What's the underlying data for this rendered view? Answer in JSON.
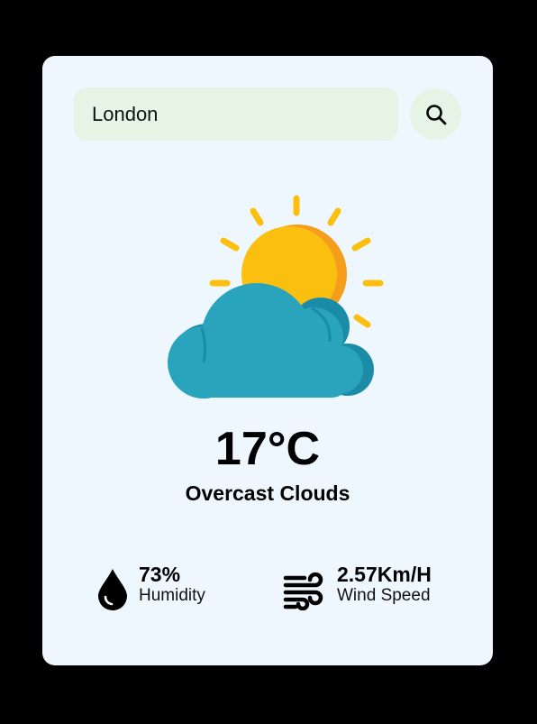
{
  "search": {
    "value": "London",
    "button_icon": "search-icon"
  },
  "weather": {
    "icon": "sun-behind-cloud-icon",
    "temperature": "17°C",
    "condition": "Overcast Clouds"
  },
  "stats": {
    "humidity": {
      "icon": "water-drop-icon",
      "value": "73%",
      "label": "Humidity"
    },
    "wind": {
      "icon": "wind-icon",
      "value": "2.57Km/H",
      "label": "Wind Speed"
    }
  },
  "colors": {
    "background": "#000000",
    "card": "#eff7fe",
    "search_bg": "#e6f4e6",
    "sun": "#fbbf0f",
    "sun_shade": "#f59e1c",
    "cloud": "#2aa3bd",
    "cloud_shade": "#1a8ca8"
  }
}
